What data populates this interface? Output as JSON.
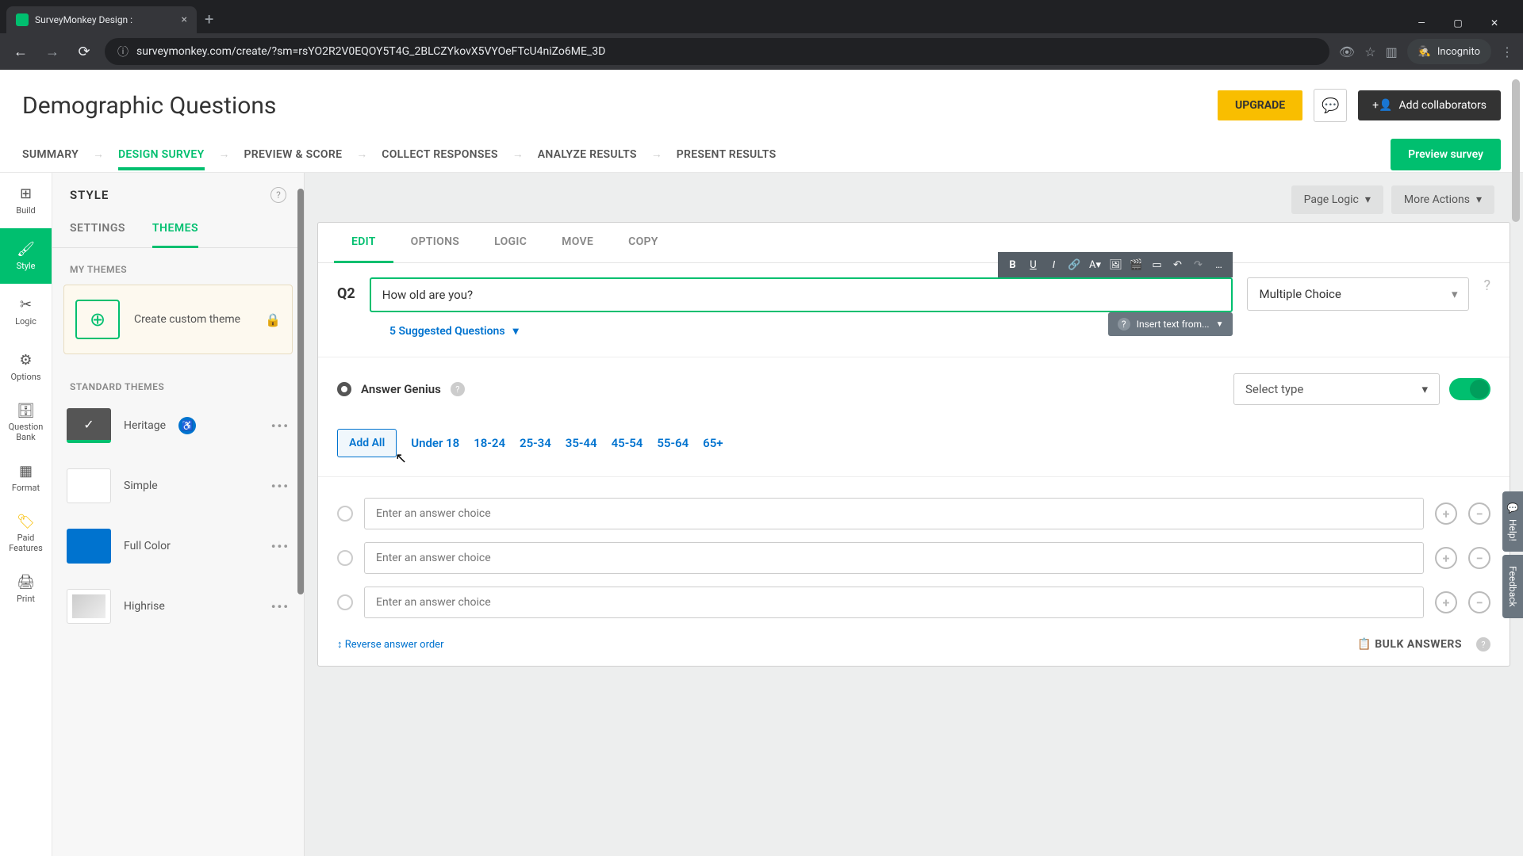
{
  "browser": {
    "tab_title": "SurveyMonkey Design :",
    "url": "surveymonkey.com/create/?sm=rsYO2R2V0EQOY5T4G_2BLCZYkovX5VYOeFTcU4niZo6ME_3D",
    "incognito_label": "Incognito"
  },
  "header": {
    "title": "Demographic Questions",
    "upgrade": "UPGRADE",
    "collab": "Add collaborators"
  },
  "nav": {
    "tabs": [
      "SUMMARY",
      "DESIGN SURVEY",
      "PREVIEW & SCORE",
      "COLLECT RESPONSES",
      "ANALYZE RESULTS",
      "PRESENT RESULTS"
    ],
    "preview": "Preview survey"
  },
  "rail": {
    "items": [
      {
        "label": "Build"
      },
      {
        "label": "Style"
      },
      {
        "label": "Logic"
      },
      {
        "label": "Options"
      },
      {
        "label": "Question Bank"
      },
      {
        "label": "Format"
      },
      {
        "label": "Paid Features"
      },
      {
        "label": "Print"
      }
    ]
  },
  "style_panel": {
    "title": "STYLE",
    "subtabs": {
      "settings": "SETTINGS",
      "themes": "THEMES"
    },
    "my_themes": "MY THEMES",
    "create_theme": "Create custom theme",
    "standard_themes": "STANDARD THEMES",
    "themes": [
      {
        "name": "Heritage"
      },
      {
        "name": "Simple"
      },
      {
        "name": "Full Color"
      },
      {
        "name": "Highrise"
      }
    ]
  },
  "canvas": {
    "page_logic": "Page Logic",
    "more_actions": "More Actions"
  },
  "question": {
    "tabs": {
      "edit": "EDIT",
      "options": "OPTIONS",
      "logic": "LOGIC",
      "move": "MOVE",
      "copy": "COPY"
    },
    "number": "Q2",
    "text": "How old are you?",
    "type": "Multiple Choice",
    "insert_from": "Insert text from...",
    "suggested": "5 Suggested Questions",
    "genius": {
      "label": "Answer Genius",
      "select": "Select type"
    },
    "chips": {
      "add_all": "Add All",
      "items": [
        "Under 18",
        "18-24",
        "25-34",
        "35-44",
        "45-54",
        "55-64",
        "65+"
      ]
    },
    "answer_placeholder": "Enter an answer choice",
    "reverse": "Reverse answer order",
    "bulk": "BULK ANSWERS"
  },
  "floaters": {
    "help": "Help!",
    "feedback": "Feedback"
  }
}
